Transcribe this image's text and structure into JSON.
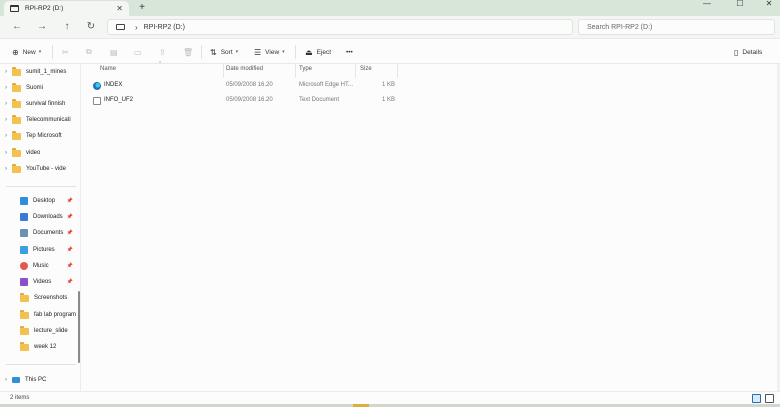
{
  "window": {
    "tab_title": "RPI-RP2 (D:)",
    "newtab_label": "+",
    "controls": [
      "—",
      "☐",
      "✕"
    ]
  },
  "nav": {
    "back": "←",
    "forward": "→",
    "up": "↑",
    "refresh": "↻",
    "path_chevron": "›",
    "path": "RPI-RP2 (D:)",
    "search_placeholder": "Search RPI-RP2 (D:)"
  },
  "commands": {
    "new_label": "New",
    "new_icon": "⊕",
    "cut_icon": "✂",
    "copy_icon": "⧉",
    "paste_icon": "▤",
    "rename_icon": "▭",
    "share_icon": "⇪",
    "delete_icon": "🗑",
    "sort_label": "Sort",
    "sort_icon": "⇅",
    "view_label": "View",
    "view_icon": "☰",
    "eject_label": "Eject",
    "eject_icon": "⏏",
    "more_label": "•••",
    "details_label": "Details",
    "details_icon": "▯"
  },
  "sidebar": {
    "folders": [
      {
        "label": "sumit_1_mines"
      },
      {
        "label": "Suomi"
      },
      {
        "label": "survival finnish"
      },
      {
        "label": "Telecommunicati"
      },
      {
        "label": "Tep Microsoft"
      },
      {
        "label": "video"
      },
      {
        "label": "YouTube - vide"
      }
    ],
    "quick_access": [
      {
        "label": "Desktop",
        "color": "#2f8fd8",
        "pinned": true
      },
      {
        "label": "Downloads",
        "color": "#3a7bd5",
        "pinned": true
      },
      {
        "label": "Documents",
        "color": "#6b8fb5",
        "pinned": true
      },
      {
        "label": "Pictures",
        "color": "#3ba0e0",
        "pinned": true
      },
      {
        "label": "Music",
        "color": "#e05a4f",
        "pinned": true
      },
      {
        "label": "Videos",
        "color": "#8a4fc9",
        "pinned": true
      },
      {
        "label": "Screenshots",
        "color": "#f2c14e",
        "pinned": false
      },
      {
        "label": "fab lab program",
        "color": "#f2c14e",
        "pinned": false
      },
      {
        "label": "lecture_slide",
        "color": "#f2c14e",
        "pinned": false
      },
      {
        "label": "week 12",
        "color": "#f2c14e",
        "pinned": false
      }
    ],
    "this_pc_label": "This PC",
    "expand_glyph": "›",
    "pin_glyph": "📌"
  },
  "filelist": {
    "columns": [
      "Name",
      "Date modified",
      "Type",
      "Size"
    ],
    "rows": [
      {
        "name": "INDEX",
        "date": "05/09/2008 16.20",
        "type": "Microsoft Edge HT...",
        "size": "1 KB",
        "icon": "edge-html-icon"
      },
      {
        "name": "INFO_UF2",
        "date": "05/09/2008 16.20",
        "type": "Text Document",
        "size": "1 KB",
        "icon": "text-file-icon"
      }
    ]
  },
  "status": {
    "item_count": "2 items"
  }
}
